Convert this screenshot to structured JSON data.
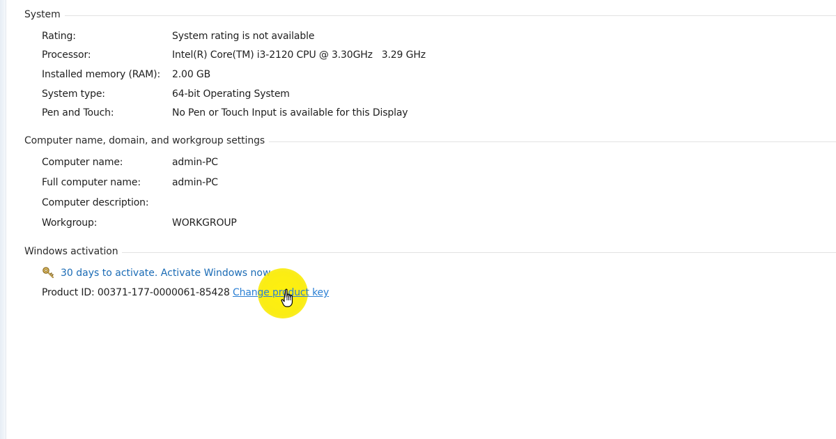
{
  "system": {
    "title": "System",
    "rows": [
      {
        "label": "Rating:",
        "value": "System rating is not available",
        "is_link": true
      },
      {
        "label": "Processor:",
        "value": "Intel(R) Core(TM) i3-2120 CPU @ 3.30GHz   3.29 GHz",
        "is_link": false
      },
      {
        "label": "Installed memory (RAM):",
        "value": "2.00 GB",
        "is_link": false
      },
      {
        "label": "System type:",
        "value": "64-bit Operating System",
        "is_link": false
      },
      {
        "label": "Pen and Touch:",
        "value": "No Pen or Touch Input is available for this Display",
        "is_link": false
      }
    ]
  },
  "computer": {
    "title": "Computer name, domain, and workgroup settings",
    "rows": [
      {
        "label": "Computer name:",
        "value": "admin-PC"
      },
      {
        "label": "Full computer name:",
        "value": "admin-PC"
      },
      {
        "label": "Computer description:",
        "value": ""
      },
      {
        "label": "Workgroup:",
        "value": "WORKGROUP"
      }
    ]
  },
  "activation": {
    "title": "Windows activation",
    "activate_link": "30 days to activate. Activate Windows now",
    "key_icon": "key-icon",
    "product_id": "Product ID: 00371-177-0000061-85428",
    "change_key_link": "Change product key"
  },
  "colors": {
    "link": "#1a6bb5",
    "highlight": "#f7ea00",
    "section_line": "#e2e2e2"
  }
}
